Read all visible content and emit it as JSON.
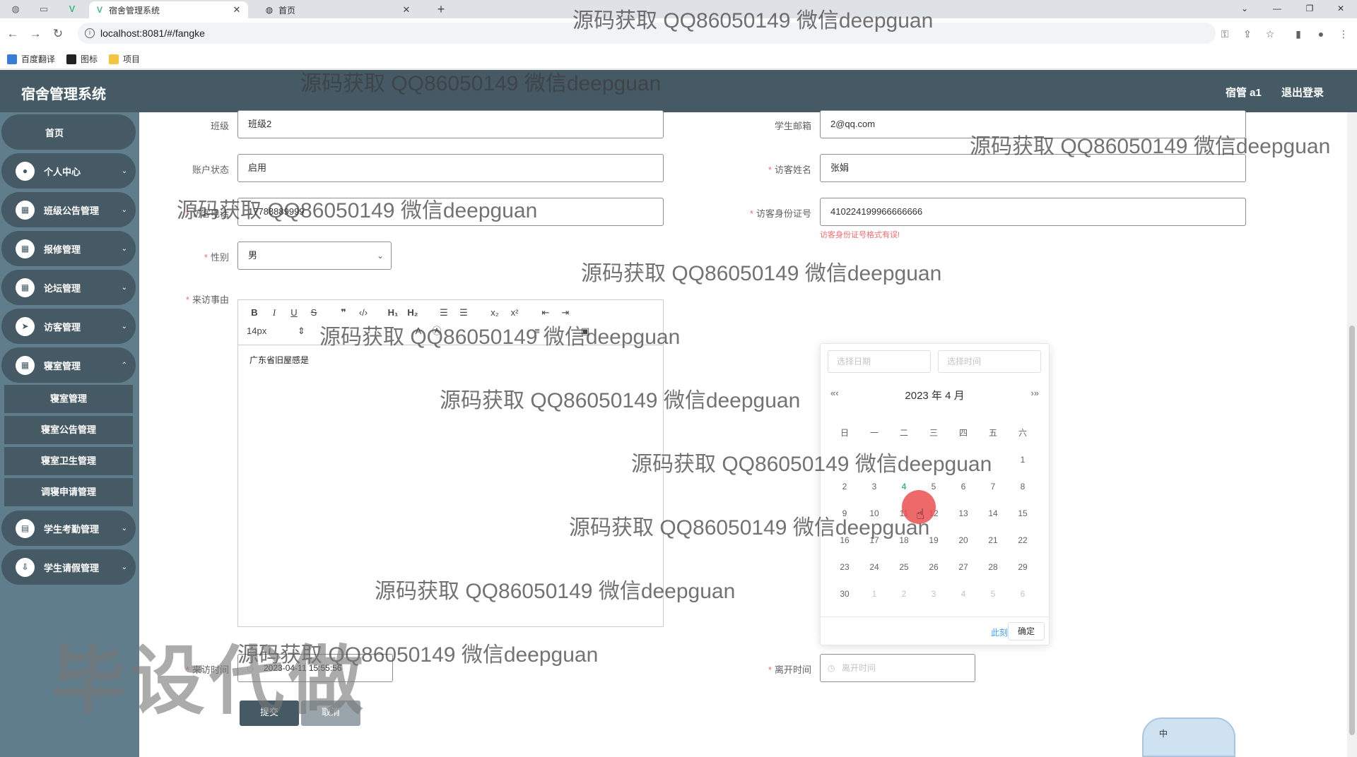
{
  "browser": {
    "tabs": [
      {
        "title": "宿舍管理系统",
        "active": true
      },
      {
        "title": "首页",
        "active": false
      }
    ],
    "url": "localhost:8081/#/fangke",
    "bookmarks": [
      "百度翻译",
      "图标",
      "项目"
    ]
  },
  "header": {
    "title": "宿舍管理系统",
    "user": "宿管 a1",
    "logout": "退出登录"
  },
  "sidebar": {
    "home": "首页",
    "menus": [
      {
        "label": "个人中心",
        "icon": "user-icon"
      },
      {
        "label": "班级公告管理",
        "icon": "grid-icon"
      },
      {
        "label": "报修管理",
        "icon": "grid-icon"
      },
      {
        "label": "论坛管理",
        "icon": "grid-icon"
      },
      {
        "label": "访客管理",
        "icon": "send-icon"
      },
      {
        "label": "寝室管理",
        "icon": "grid-icon"
      }
    ],
    "submenu": [
      "寝室管理",
      "寝室公告管理",
      "寝室卫生管理",
      "调寝申请管理"
    ],
    "menus_after": [
      {
        "label": "学生考勤管理",
        "icon": "clipboard-icon"
      },
      {
        "label": "学生请假管理",
        "icon": "download-icon"
      }
    ]
  },
  "form": {
    "class_label": "班级",
    "class_value": "班级2",
    "email_label": "学生邮箱",
    "email_value": "2@qq.com",
    "status_label": "账户状态",
    "status_value": "启用",
    "visitor_name_label": "访客姓名",
    "visitor_name_value": "张娟",
    "visitor_phone_label": "访客电话",
    "visitor_phone_value": "17788889999",
    "visitor_id_label": "访客身份证号",
    "visitor_id_value": "410224199966666666",
    "visitor_id_error": "访客身份证号格式有误!",
    "gender_label": "性别",
    "gender_value": "男",
    "reason_label": "来访事由",
    "editor_font_size": "14px",
    "editor_content": "广东省旧屋感是",
    "arrive_label": "来访时间",
    "arrive_value": "2023-04-11 15:55:56",
    "leave_label": "离开时间",
    "leave_placeholder": "离开时间",
    "submit": "提交",
    "cancel": "取消"
  },
  "picker": {
    "date_placeholder": "选择日期",
    "time_placeholder": "选择时间",
    "header": "2023 年  4 月",
    "weekdays": [
      "日",
      "一",
      "二",
      "三",
      "四",
      "五",
      "六"
    ],
    "today": "4",
    "now": "此刻",
    "confirm": "确定"
  },
  "watermark": {
    "text": "源码获取 QQ86050149 微信deepguan",
    "big": "毕设代做"
  },
  "widget": {
    "label": "中"
  },
  "colors": {
    "header": "#455a64",
    "sidebar": "#607d8b",
    "accent": "#42b983",
    "error": "#f56c6c"
  }
}
